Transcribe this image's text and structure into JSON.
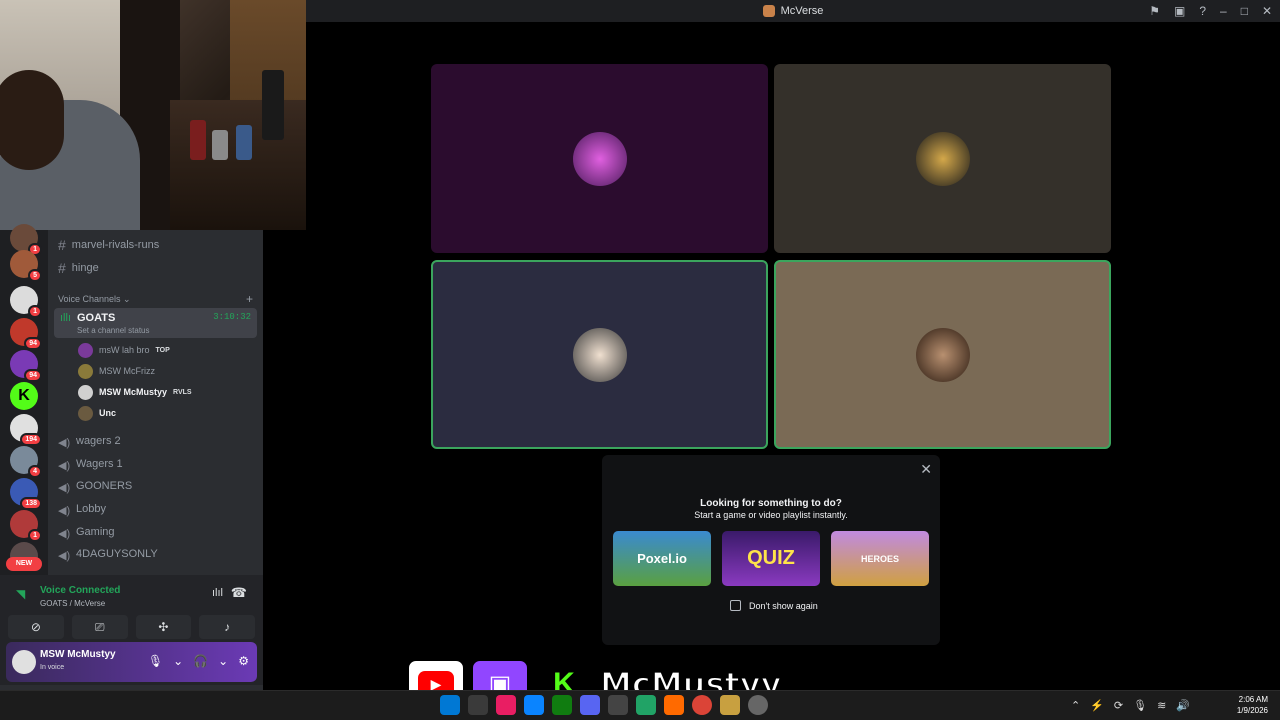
{
  "window": {
    "title": "McVerse"
  },
  "sidebar": {
    "guild_badges": [
      "1",
      "5",
      "1",
      "94",
      "94",
      "",
      "194",
      "4",
      "138",
      "1",
      ""
    ],
    "new_label": "NEW",
    "text_channels": [
      "marvel-rivals-runs",
      "hinge"
    ],
    "voice_header": "Voice Channels",
    "active_voice": {
      "name": "GOATS",
      "status": "Set a channel status",
      "timer": "3:10:32"
    },
    "voice_users": [
      {
        "name": "msW lah bro",
        "tag": "TOP"
      },
      {
        "name": "MSW McFrizz",
        "tag": ""
      },
      {
        "name": "MSW McMustyy",
        "tag": "RVLS"
      },
      {
        "name": "Unc",
        "tag": ""
      }
    ],
    "voice_channels": [
      "wagers 2",
      "Wagers 1",
      "GOONERS",
      "Lobby",
      "Gaming",
      "4DAGUYSONLY"
    ]
  },
  "voice_bar": {
    "connected": "Voice Connected",
    "location": "GOATS / McVerse"
  },
  "user_panel": {
    "name": "MSW McMustyy",
    "status": "In voice"
  },
  "activity": {
    "line1": "Looking for something to do?",
    "line2": "Start a game or video playlist instantly.",
    "games": [
      "Poxel.io",
      "QUIZ",
      "HEROES"
    ],
    "dont_show": "Don't show again"
  },
  "overlay": {
    "handle": "McMustyy"
  },
  "taskbar": {
    "time": "2:06 AM",
    "date": "1/9/2026"
  },
  "colors": {
    "accent_green": "#23a55a",
    "tile1": "#2b0c2e",
    "tile2": "#34302a",
    "tile3": "#2b2c40",
    "tile4": "#7a6a55"
  }
}
